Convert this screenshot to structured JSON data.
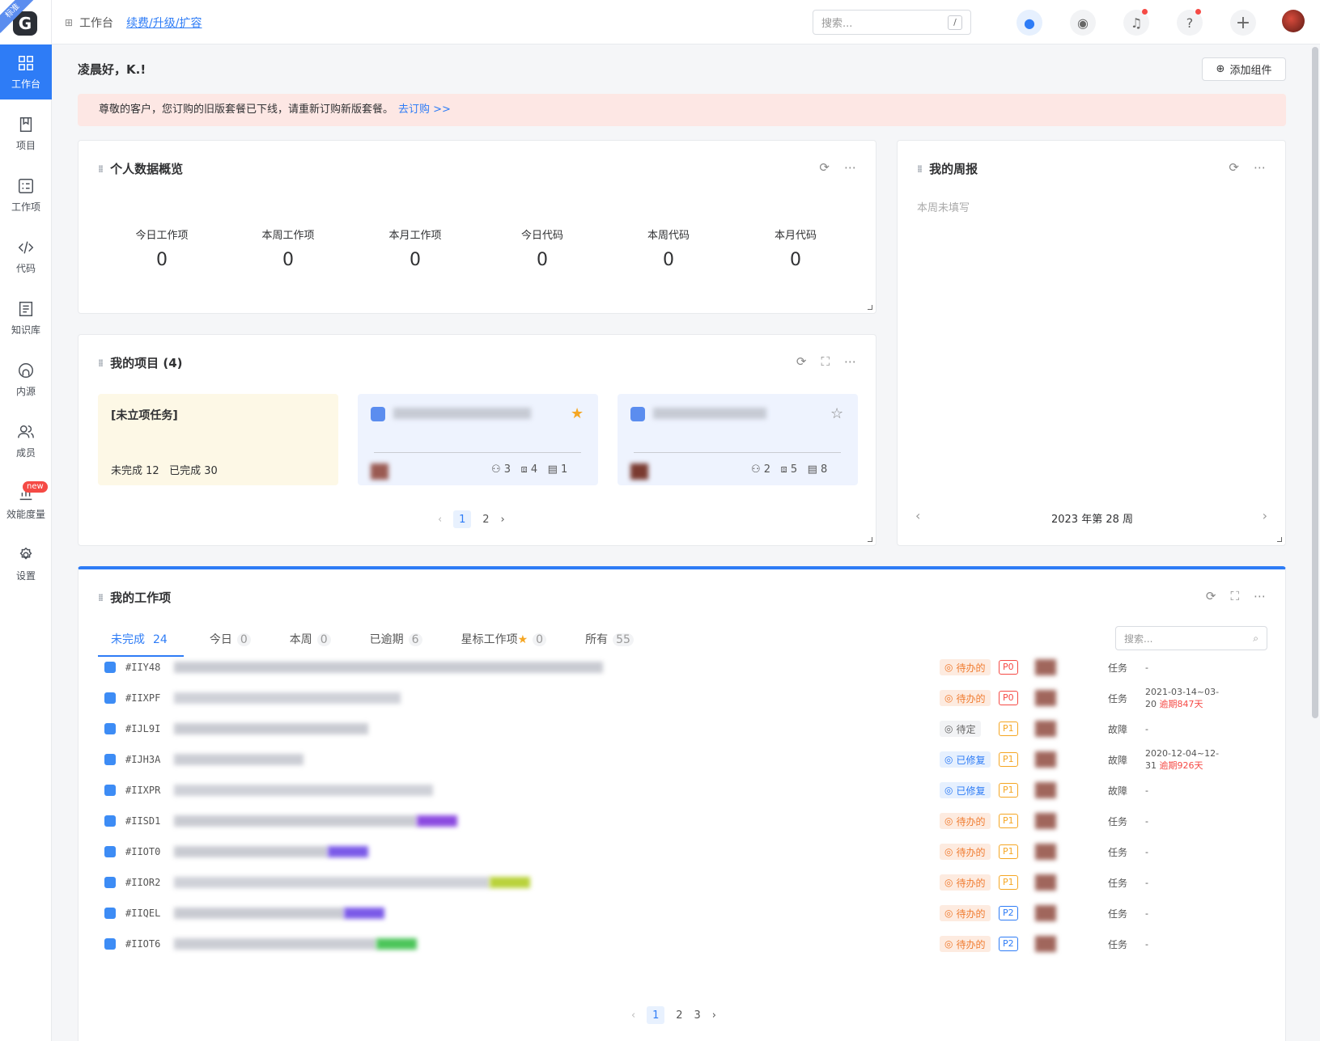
{
  "brand": {
    "logo_letter": "G",
    "edition": "标准"
  },
  "sidebar": {
    "items": [
      {
        "label": "工作台",
        "icon": "dashboard-icon"
      },
      {
        "label": "项目",
        "icon": "book-icon"
      },
      {
        "label": "工作项",
        "icon": "checklist-icon"
      },
      {
        "label": "代码",
        "icon": "code-icon"
      },
      {
        "label": "知识库",
        "icon": "document-icon"
      },
      {
        "label": "内源",
        "icon": "source-icon"
      },
      {
        "label": "成员",
        "icon": "members-icon"
      },
      {
        "label": "效能度量",
        "icon": "chart-icon",
        "badge": "new"
      },
      {
        "label": "设置",
        "icon": "gear-icon"
      }
    ]
  },
  "topbar": {
    "crumb": "工作台",
    "link": "续费/升级/扩容",
    "search_placeholder": "搜索...",
    "search_shortcut": "/"
  },
  "greeting": "凌晨好，K.!",
  "add_widget": "添加组件",
  "notice": {
    "text": "尊敬的客户，您订购的旧版套餐已下线，请重新订购新版套餐。",
    "link": "去订购 >>"
  },
  "overview": {
    "title": "个人数据概览",
    "stats": [
      {
        "label": "今日工作项",
        "value": "0"
      },
      {
        "label": "本周工作项",
        "value": "0"
      },
      {
        "label": "本月工作项",
        "value": "0"
      },
      {
        "label": "今日代码",
        "value": "0"
      },
      {
        "label": "本周代码",
        "value": "0"
      },
      {
        "label": "本月代码",
        "value": "0"
      }
    ]
  },
  "weekly": {
    "title": "我的周报",
    "empty": "本周未填写",
    "week": "2023 年第 28 周"
  },
  "projects": {
    "title": "我的项目 (4)",
    "unassigned": {
      "name": "[未立项任务]",
      "incomplete": "未完成 12",
      "complete": "已完成 30"
    },
    "cards": [
      {
        "members": "3",
        "repos": "4",
        "items": "1",
        "starred": true
      },
      {
        "members": "2",
        "repos": "5",
        "items": "8",
        "starred": false
      }
    ],
    "pages": [
      "1",
      "2"
    ]
  },
  "workitems": {
    "title": "我的工作项",
    "search_placeholder": "搜索...",
    "tabs": [
      {
        "label": "未完成",
        "count": "24"
      },
      {
        "label": "今日",
        "count": "0"
      },
      {
        "label": "本周",
        "count": "0"
      },
      {
        "label": "已逾期",
        "count": "6"
      },
      {
        "label": "星标工作项",
        "count": "0"
      },
      {
        "label": "所有",
        "count": "55"
      }
    ],
    "rows": [
      {
        "id": "#IIY48",
        "status": "待办的",
        "st": "todo",
        "prio": "P0",
        "type": "任务",
        "date": "-",
        "overdue": ""
      },
      {
        "id": "#IIXPF",
        "status": "待办的",
        "st": "todo",
        "prio": "P0",
        "type": "任务",
        "date": "2021-03-14~03-20",
        "overdue": "逾期847天"
      },
      {
        "id": "#IJL9I",
        "status": "待定",
        "st": "pend",
        "prio": "P1",
        "type": "故障",
        "date": "-",
        "overdue": ""
      },
      {
        "id": "#IJH3A",
        "status": "已修复",
        "st": "fix",
        "prio": "P1",
        "type": "故障",
        "date": "2020-12-04~12-31",
        "overdue": "逾期926天"
      },
      {
        "id": "#IIXPR",
        "status": "已修复",
        "st": "fix",
        "prio": "P1",
        "type": "故障",
        "date": "-",
        "overdue": ""
      },
      {
        "id": "#IISD1",
        "status": "待办的",
        "st": "todo",
        "prio": "P1",
        "type": "任务",
        "date": "-",
        "overdue": ""
      },
      {
        "id": "#IIOT0",
        "status": "待办的",
        "st": "todo",
        "prio": "P1",
        "type": "任务",
        "date": "-",
        "overdue": ""
      },
      {
        "id": "#IIOR2",
        "status": "待办的",
        "st": "todo",
        "prio": "P1",
        "type": "任务",
        "date": "-",
        "overdue": ""
      },
      {
        "id": "#IIQEL",
        "status": "待办的",
        "st": "todo",
        "prio": "P2",
        "type": "任务",
        "date": "-",
        "overdue": ""
      },
      {
        "id": "#IIOT6",
        "status": "待办的",
        "st": "todo",
        "prio": "P2",
        "type": "任务",
        "date": "-",
        "overdue": ""
      }
    ],
    "pages": [
      "1",
      "2",
      "3"
    ]
  }
}
